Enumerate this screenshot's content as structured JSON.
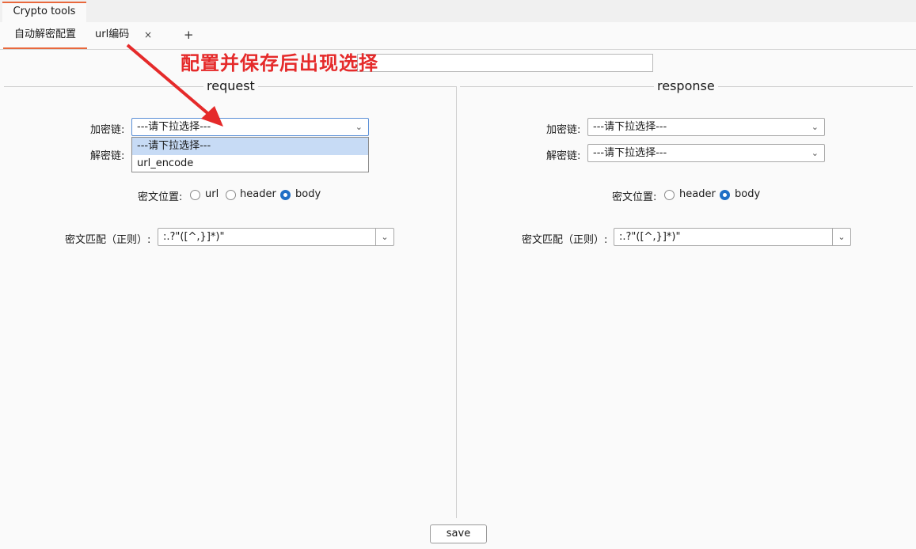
{
  "app_tab": "Crypto tools",
  "tabs": [
    {
      "label": "自动解密配置",
      "active": true
    },
    {
      "label": "url编码",
      "close": "×"
    }
  ],
  "add_tab": "+",
  "annotation": "配置并保存后出现选择",
  "request": {
    "title": "request",
    "encrypt_chain_label": "加密链:",
    "encrypt_chain_value": "---请下拉选择---",
    "decrypt_chain_label": "解密链:",
    "dropdown_options": [
      "---请下拉选择---",
      "url_encode"
    ],
    "position_label": "密文位置:",
    "positions": [
      "url",
      "header",
      "body"
    ],
    "selected_position": "body",
    "match_label": "密文匹配（正则）:",
    "match_value": ":.?\"([^,}]*)\""
  },
  "response": {
    "title": "response",
    "encrypt_chain_label": "加密链:",
    "encrypt_chain_value": "---请下拉选择---",
    "decrypt_chain_label": "解密链:",
    "decrypt_chain_value": "---请下拉选择---",
    "position_label": "密文位置:",
    "positions": [
      "header",
      "body"
    ],
    "selected_position": "body",
    "match_label": "密文匹配（正则）:",
    "match_value": ":.?\"([^,}]*)\""
  },
  "save_label": "save",
  "colors": {
    "accent": "#e8683c",
    "annotation": "#e52a2a",
    "radio_on": "#1f6fc6",
    "dropdown_selected": "#c7dbf5"
  }
}
